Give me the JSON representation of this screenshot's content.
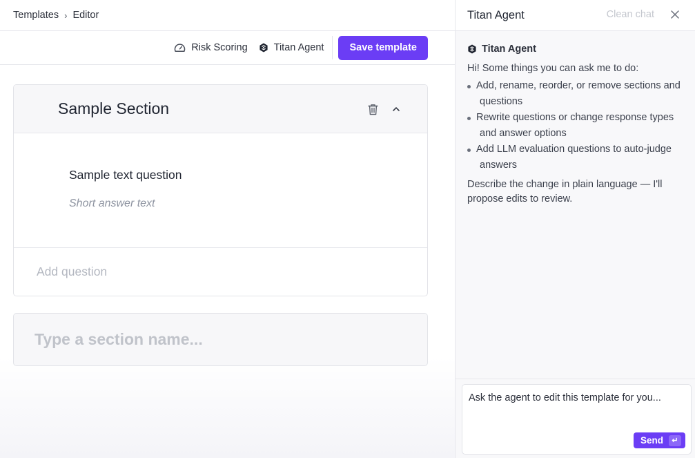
{
  "breadcrumb": {
    "items": [
      "Templates",
      "Editor"
    ],
    "separator": "›"
  },
  "toolbar": {
    "risk_scoring_label": "Risk Scoring",
    "titan_agent_label": "Titan Agent",
    "save_label": "Save template"
  },
  "section": {
    "title": "Sample Section",
    "question": {
      "title": "Sample text question",
      "answer_placeholder": "Short answer text"
    },
    "add_question_label": "Add question"
  },
  "new_section": {
    "placeholder": "Type a section name..."
  },
  "agent_panel": {
    "title": "Titan Agent",
    "clean_chat_label": "Clean chat",
    "message": {
      "author": "Titan Agent",
      "intro": "Hi! Some things you can ask me to do:",
      "items": [
        {
          "line1": "Add, rename, reorder, or remove sections and",
          "line2": "questions"
        },
        {
          "line1": "Rewrite questions or change response types",
          "line2": "and answer options"
        },
        {
          "line1": "Add LLM evaluation questions to auto-judge",
          "line2": "answers"
        }
      ],
      "outro": "Describe the change in plain language — I'll propose edits to review."
    },
    "composer": {
      "placeholder": "Ask the agent to edit this template for you...",
      "send_label": "Send",
      "send_key": "↵"
    }
  },
  "colors": {
    "accent": "#6b3df5",
    "border": "#e2e3e8",
    "muted_text": "#8d93a0"
  },
  "icons": {
    "risk_scoring": "gauge-icon",
    "titan_agent": "agent-logo-icon",
    "delete": "trash-icon",
    "collapse": "chevron-up-icon",
    "close": "close-icon",
    "send_key": "enter-key-icon"
  }
}
